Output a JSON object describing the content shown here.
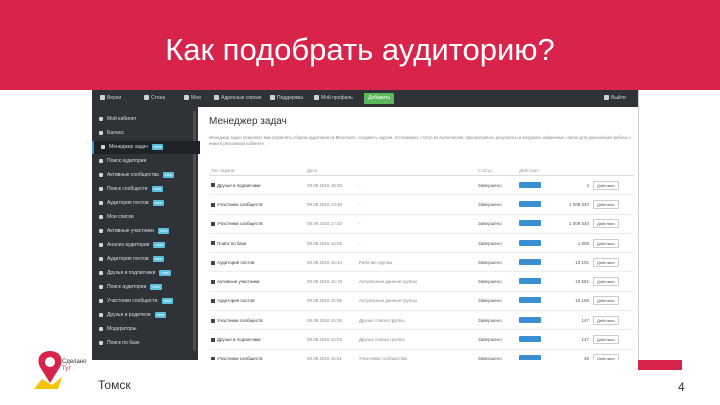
{
  "slide": {
    "title": "Как подобрать аудиторию?",
    "city": "Томск",
    "page_number": "4",
    "logo_text": "Сделано Тут",
    "accent": "#d8244a"
  },
  "app": {
    "nav": [
      "Верхи",
      "Стена",
      "Мои",
      "Адресные списки",
      "Поддержка",
      "Мой профиль"
    ],
    "add_button": "Добавить",
    "logout": "Выйти",
    "page_heading": "Менеджер задач",
    "description": "Менеджер задач позволяет вам управлять сбором аудитории из ВКонтакте: создавать задачи, отслеживать статус их выполнения, просматривать результаты и загружать найденные списки для дальнейшей работы с ними в рекламном кабинете.",
    "sidebar": [
      {
        "label": "Мой кабинет",
        "badge": ""
      },
      {
        "label": "Баланс",
        "badge": ""
      },
      {
        "label": "Менеджер задач",
        "badge": "new",
        "active": true
      },
      {
        "label": "Поиск аудитории",
        "badge": ""
      },
      {
        "label": "Активные сообщества",
        "badge": "new"
      },
      {
        "label": "Поиск сообществ",
        "badge": "new"
      },
      {
        "label": "Аудитория постов",
        "badge": "new"
      },
      {
        "label": "Мои списки",
        "badge": ""
      },
      {
        "label": "Активные участники",
        "badge": "new"
      },
      {
        "label": "Анализ аудитории",
        "badge": "new"
      },
      {
        "label": "Аудитория постов",
        "badge": "new"
      },
      {
        "label": "Друзья и подписчики",
        "badge": "new"
      },
      {
        "label": "Поиск аудитории",
        "badge": "new"
      },
      {
        "label": "Участники сообществ",
        "badge": "new"
      },
      {
        "label": "Друзья и родители",
        "badge": "new"
      },
      {
        "label": "Модераторы",
        "badge": ""
      },
      {
        "label": "Поиск по базе",
        "badge": ""
      }
    ],
    "table": {
      "headers": [
        "Тип задачи",
        "Дата",
        "",
        "Статус",
        "Действия",
        "",
        ""
      ],
      "rows": [
        {
          "name": "Друзья и подписчики",
          "date": "09.08.2016 19:30",
          "desc": "-",
          "status": "Завершено",
          "count": "4",
          "menu": "Действия"
        },
        {
          "name": "Участники сообществ",
          "date": "09.08.2016 19:40",
          "desc": "-",
          "status": "Завершено",
          "count": "1 008 540",
          "menu": "Действия"
        },
        {
          "name": "Участники сообществ",
          "date": "09.08.2016 17:03",
          "desc": "-",
          "status": "Завершено",
          "count": "1 008 540",
          "menu": "Действия"
        },
        {
          "name": "Поиск по базе",
          "date": "08.08.2016 16:05",
          "desc": "-",
          "status": "Завершено",
          "count": "1 008",
          "menu": "Действия"
        },
        {
          "name": "Аудитория постов",
          "date": "08.08.2016 15:44",
          "desc": "Рабочие группы",
          "status": "Завершено",
          "count": "13 101",
          "menu": "Действия"
        },
        {
          "name": "Активные участники",
          "date": "08.08.2016 15:19",
          "desc": "Актуальные данные группы",
          "status": "Завершено",
          "count": "10 561",
          "menu": "Действия"
        },
        {
          "name": "Аудитория постов",
          "date": "08.08.2016 15:06",
          "desc": "Актуальные данные группы",
          "status": "Завершено",
          "count": "15 156",
          "menu": "Действия"
        },
        {
          "name": "Участники сообществ",
          "date": "08.08.2016 15:06",
          "desc": "Друзья списка группы",
          "status": "Завершено",
          "count": "147",
          "menu": "Действия"
        },
        {
          "name": "Друзья и подписчики",
          "date": "08.08.2016 15:03",
          "desc": "Друзья списка группы",
          "status": "Завершено",
          "count": "147",
          "menu": "Действия"
        },
        {
          "name": "Участники сообществ",
          "date": "08.08.2016 15:01",
          "desc": "Участники сообщества",
          "status": "Завершено",
          "count": "45",
          "menu": "Действия"
        },
        {
          "name": "Аудитория постов",
          "date": "08.08.2016 14:58",
          "desc": "Ранее друзей и подписчиков",
          "status": "Завершено",
          "count": "195",
          "menu": "Действия"
        },
        {
          "name": "Аудитория постов",
          "date": "08.08.2016 14:52",
          "desc": "Ранее друзей и подписчиков",
          "status": "Завершено",
          "count": "195",
          "menu": "Действия"
        }
      ]
    }
  }
}
